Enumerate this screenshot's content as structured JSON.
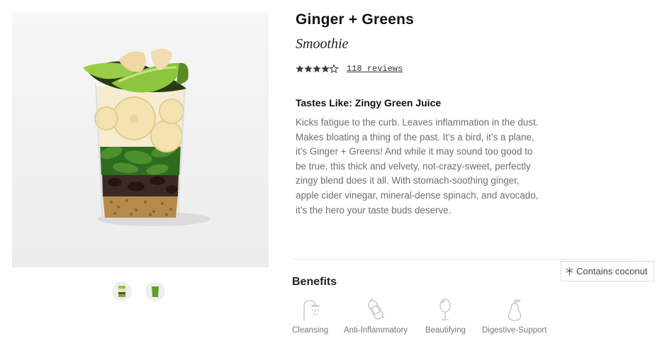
{
  "product": {
    "title": "Ginger + Greens",
    "subtitle": "Smoothie",
    "rating": 4.5,
    "reviews_label": "118 reviews",
    "tastes_like": "Tastes Like: Zingy Green Juice",
    "description": "Kicks fatigue to the curb. Leaves inflammation in the dust. Makes bloating a thing of the past. It’s a bird, it’s a plane, it’s Ginger + Greens! And while it may sound too good to be true, this thick and velvety, not-crazy-sweet, perfectly zingy blend does it all. With stomach-soothing ginger, apple cider vinegar, mineral-dense spinach, and avocado, it’s the hero your taste buds deserve."
  },
  "gallery": {
    "thumbnails": [
      {
        "icon": "layered-cup-icon"
      },
      {
        "icon": "green-cup-icon"
      }
    ]
  },
  "allergen": {
    "label": "Contains coconut",
    "icon": "coconut-palm-icon"
  },
  "benefits": {
    "title": "Benefits",
    "items": [
      {
        "label": "Cleansing",
        "icon": "shower-icon"
      },
      {
        "label": "Anti-Inflammatory",
        "icon": "bandage-icon"
      },
      {
        "label": "Beautifying",
        "icon": "mirror-icon"
      },
      {
        "label": "Digestive-Support",
        "icon": "pear-icon"
      }
    ]
  },
  "colors": {
    "star": "#3a3a3a",
    "text_muted": "#6e6e6e",
    "avocado": "#8cc63f",
    "banana": "#f4e2b0",
    "spinach": "#2f6b1f",
    "seeds": "#b58a4a"
  }
}
